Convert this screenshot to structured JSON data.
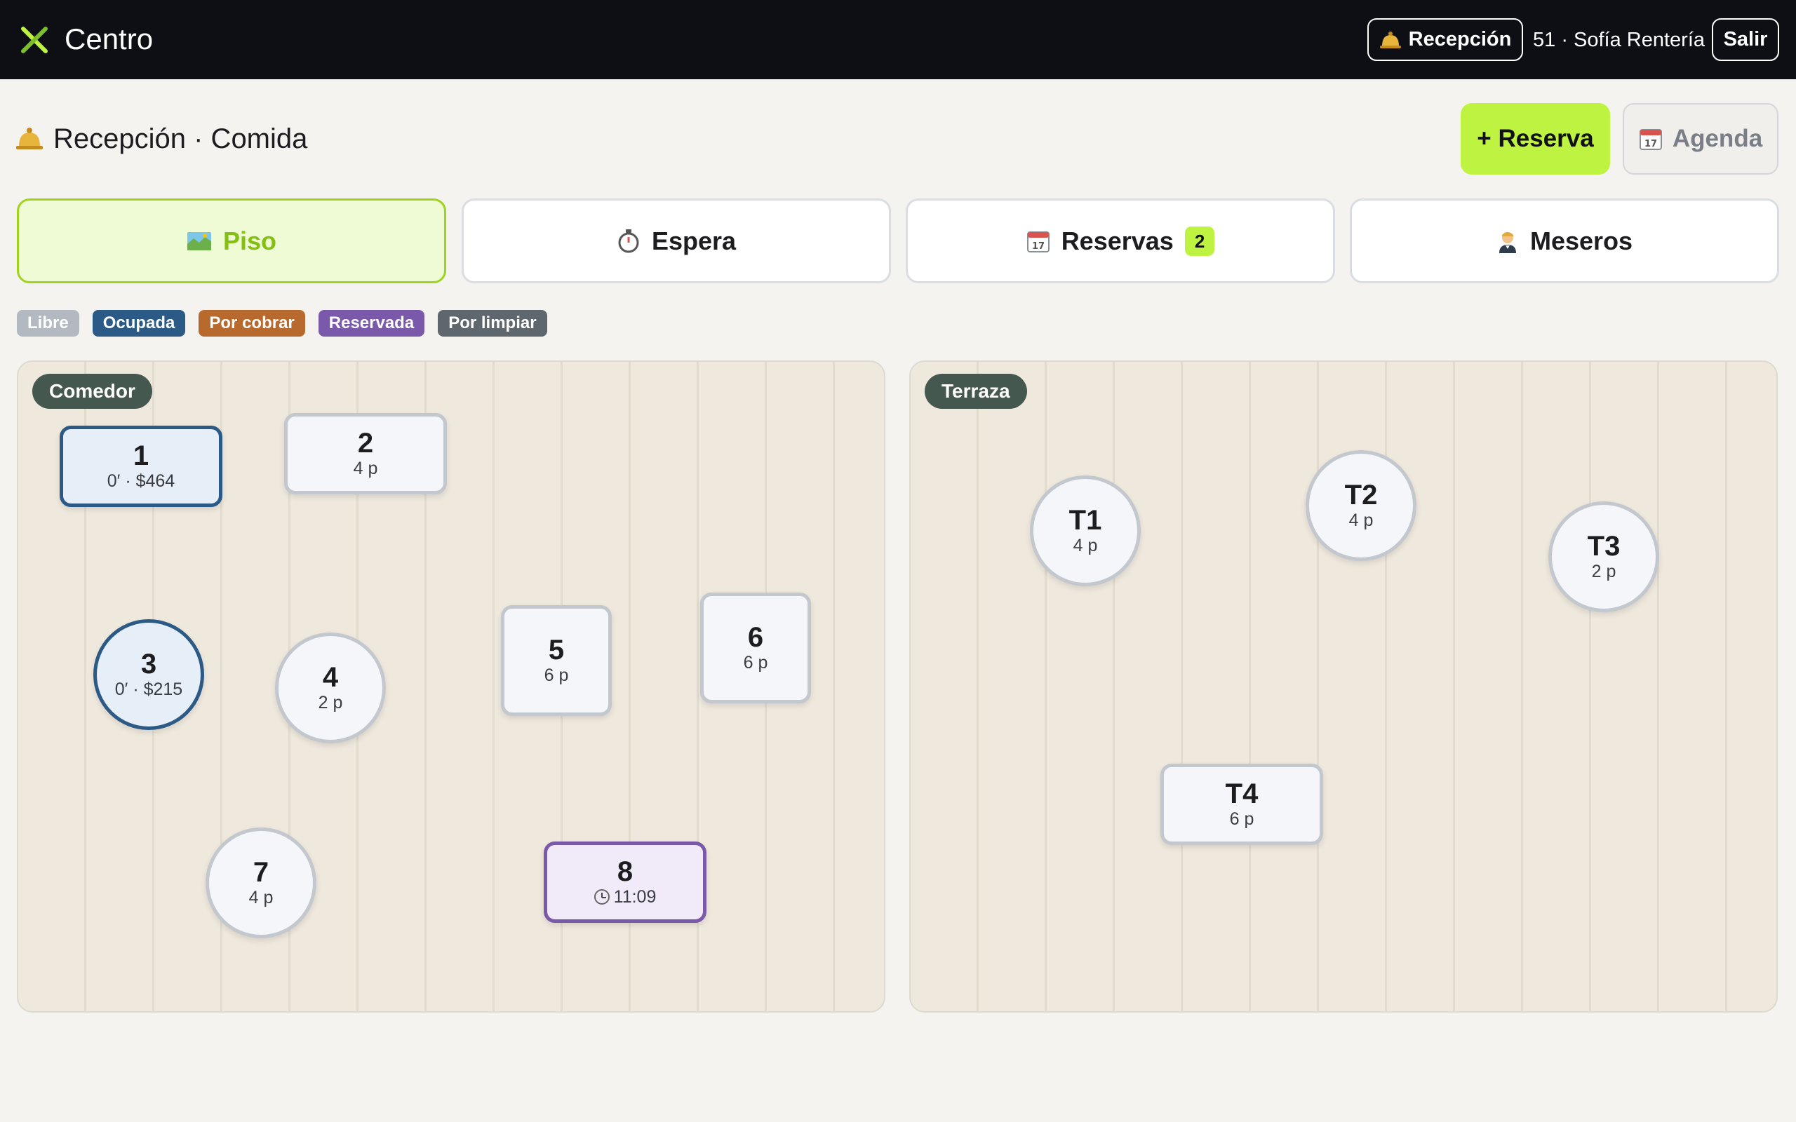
{
  "app": {
    "brand": "Centro"
  },
  "topbar": {
    "recepcion_label": "Recepción",
    "user_label": "51 · Sofía Rentería",
    "salir_label": "Salir"
  },
  "header": {
    "title": "Recepción · Comida",
    "reserva_label": "+ Reserva",
    "agenda_label": "Agenda"
  },
  "tabs": [
    {
      "label": "Piso",
      "icon": "map-icon",
      "active": true
    },
    {
      "label": "Espera",
      "icon": "stopwatch-icon",
      "active": false
    },
    {
      "label": "Reservas",
      "icon": "calendar-icon",
      "active": false,
      "badge": "2"
    },
    {
      "label": "Meseros",
      "icon": "waiter-icon",
      "active": false
    }
  ],
  "legend": [
    {
      "label": "Libre",
      "color": "#b3b9c1"
    },
    {
      "label": "Ocupada",
      "color": "#2c5a86"
    },
    {
      "label": "Por cobrar",
      "color": "#b86a2e"
    },
    {
      "label": "Reservada",
      "color": "#7a58aa"
    },
    {
      "label": "Por limpiar",
      "color": "#5f676e"
    }
  ],
  "areas": {
    "comedor": {
      "label": "Comedor",
      "tables": [
        {
          "id": "1",
          "detail": "0′ · $464",
          "status": "ocupada",
          "shape": "rect"
        },
        {
          "id": "2",
          "detail": "4 p",
          "status": "libre",
          "shape": "rect"
        },
        {
          "id": "3",
          "detail": "0′ · $215",
          "status": "ocupada",
          "shape": "round"
        },
        {
          "id": "4",
          "detail": "2 p",
          "status": "libre",
          "shape": "round"
        },
        {
          "id": "5",
          "detail": "6 p",
          "status": "libre",
          "shape": "rect"
        },
        {
          "id": "6",
          "detail": "6 p",
          "status": "libre",
          "shape": "rect"
        },
        {
          "id": "7",
          "detail": "4 p",
          "status": "libre",
          "shape": "round"
        },
        {
          "id": "8",
          "detail": "11:09",
          "status": "reservada",
          "shape": "rect"
        }
      ]
    },
    "terraza": {
      "label": "Terraza",
      "tables": [
        {
          "id": "T1",
          "detail": "4 p",
          "status": "libre",
          "shape": "round"
        },
        {
          "id": "T2",
          "detail": "4 p",
          "status": "libre",
          "shape": "round"
        },
        {
          "id": "T3",
          "detail": "2 p",
          "status": "libre",
          "shape": "round"
        },
        {
          "id": "T4",
          "detail": "6 p",
          "status": "libre",
          "shape": "rect"
        }
      ]
    }
  }
}
